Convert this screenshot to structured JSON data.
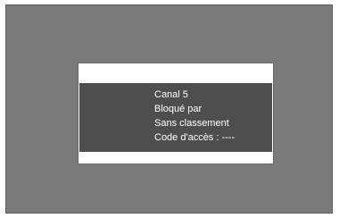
{
  "dialog": {
    "channel": "Canal 5",
    "blocked_by": "Bloqué par",
    "rating": "Sans classement",
    "access_code": "Code d'accès : ----"
  }
}
